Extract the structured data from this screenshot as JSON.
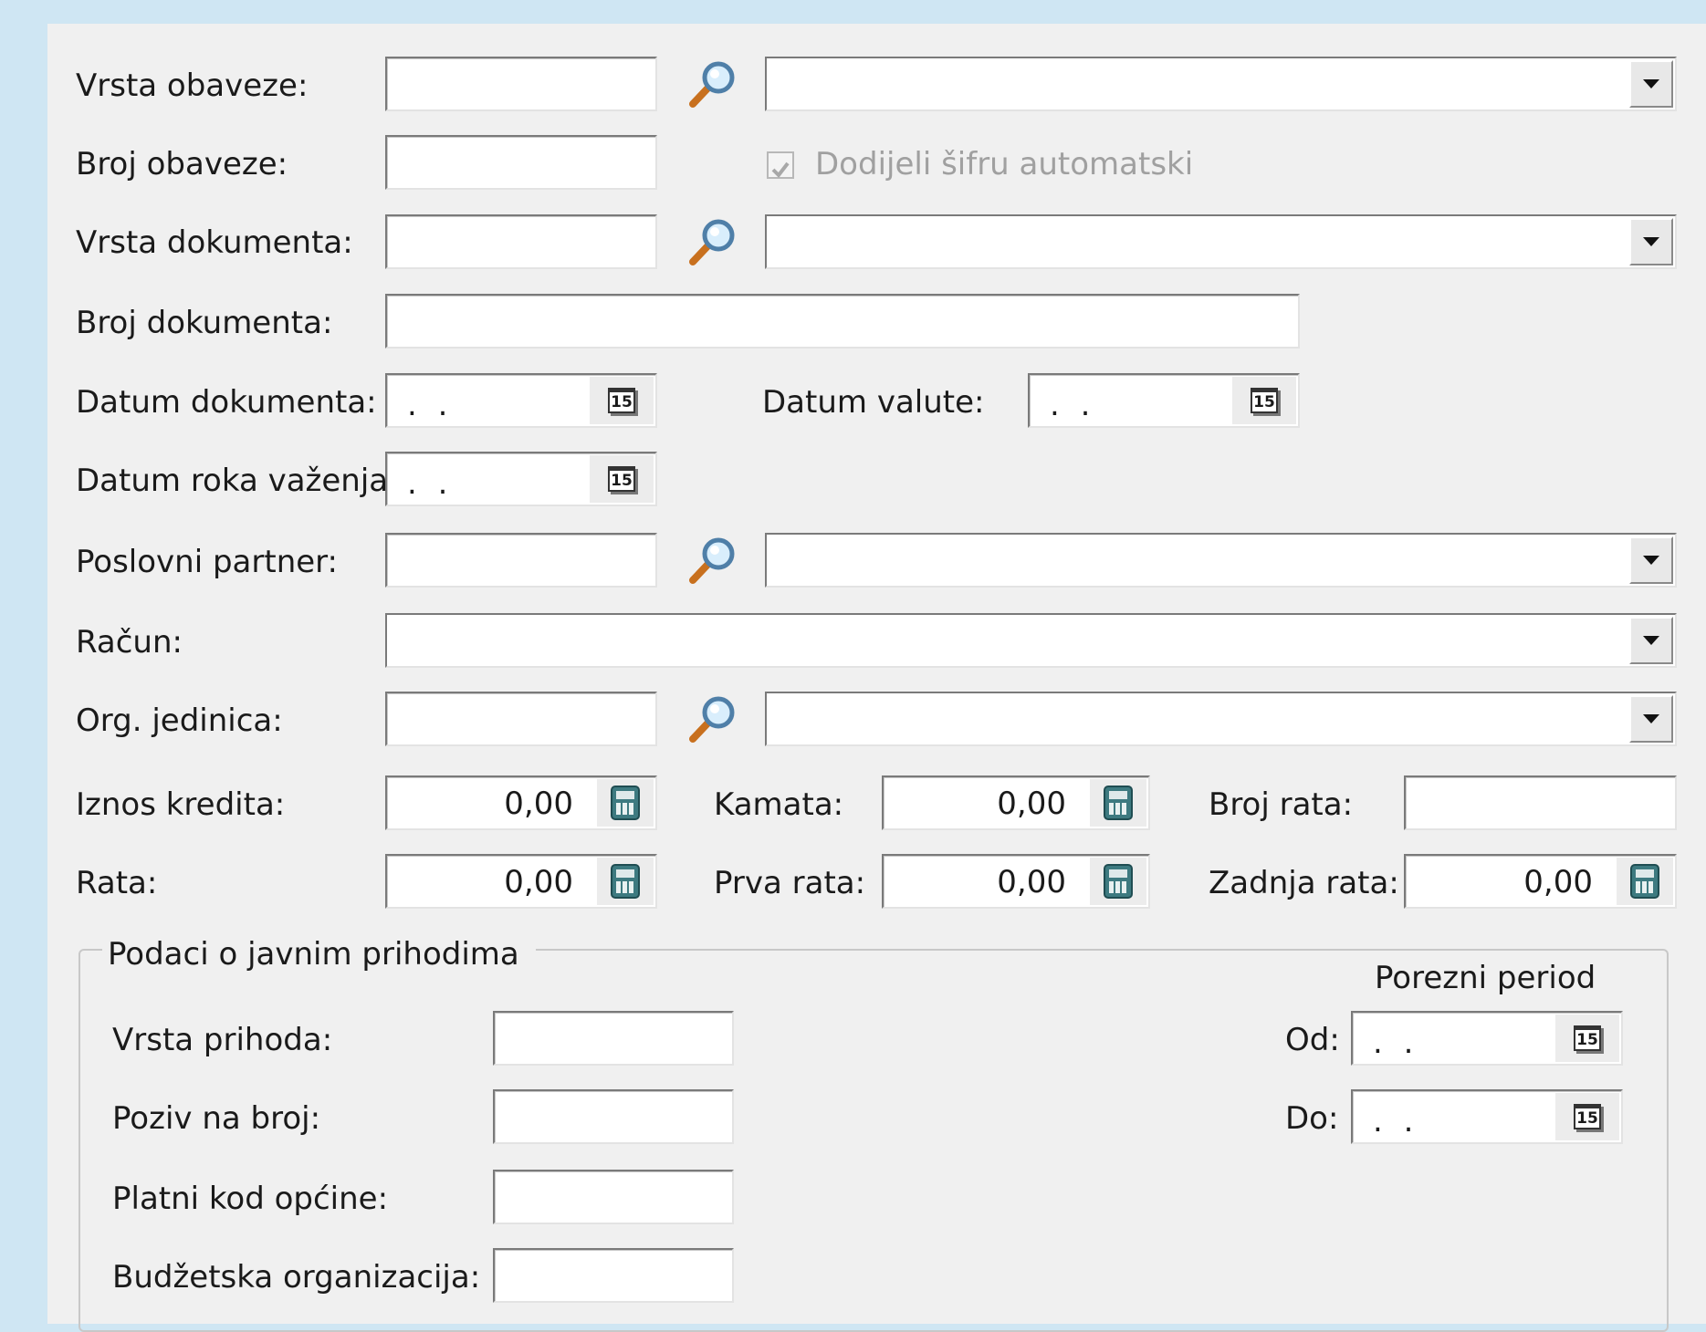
{
  "form": {
    "vrsta_obaveze": {
      "label": "Vrsta obaveze:",
      "code": "",
      "description": ""
    },
    "broj_obaveze": {
      "label": "Broj obaveze:",
      "value": ""
    },
    "auto_code": {
      "label": "Dodijeli šifru automatski",
      "checked": true,
      "enabled": false
    },
    "vrsta_dokumenta": {
      "label": "Vrsta dokumenta:",
      "code": "",
      "description": ""
    },
    "broj_dokumenta": {
      "label": "Broj dokumenta:",
      "value": ""
    },
    "datum_dokumenta": {
      "label": "Datum dokumenta:",
      "value": ". ."
    },
    "datum_valute": {
      "label": "Datum valute:",
      "value": ". ."
    },
    "datum_roka": {
      "label": "Datum roka važenja:",
      "value": ". ."
    },
    "poslovni_partner": {
      "label": "Poslovni partner:",
      "code": "",
      "description": ""
    },
    "racun": {
      "label": "Račun:",
      "value": ""
    },
    "org_jedinica": {
      "label": "Org. jedinica:",
      "code": "",
      "description": ""
    },
    "iznos_kredita": {
      "label": "Iznos kredita:",
      "value": "0,00"
    },
    "kamata": {
      "label": "Kamata:",
      "value": "0,00"
    },
    "broj_rata": {
      "label": "Broj rata:",
      "value": ""
    },
    "rata": {
      "label": "Rata:",
      "value": "0,00"
    },
    "prva_rata": {
      "label": "Prva rata:",
      "value": "0,00"
    },
    "zadnja_rata": {
      "label": "Zadnja rata:",
      "value": "0,00"
    },
    "calendar_icon_text": "15"
  },
  "public_revenue": {
    "title": "Podaci o javnim prihodima",
    "vrsta_prihoda": {
      "label": "Vrsta prihoda:",
      "value": ""
    },
    "poziv_na_broj": {
      "label": "Poziv na broj:",
      "value": ""
    },
    "platni_kod": {
      "label": "Platni kod općine:",
      "value": ""
    },
    "budzetska_org": {
      "label": "Budžetska organizacija:",
      "value": ""
    },
    "porezni_period": {
      "title": "Porezni period",
      "od": {
        "label": "Od:",
        "value": ". ."
      },
      "do": {
        "label": "Do:",
        "value": ". ."
      }
    }
  },
  "icons": {
    "search": "magnifier-icon",
    "calendar": "calendar-icon",
    "calculator": "calculator-icon",
    "dropdown": "chevron-down-icon"
  },
  "colors": {
    "window_bg": "#cfe6f3",
    "panel_bg": "#f0f0f0",
    "disabled_text": "#a0a0a0"
  }
}
